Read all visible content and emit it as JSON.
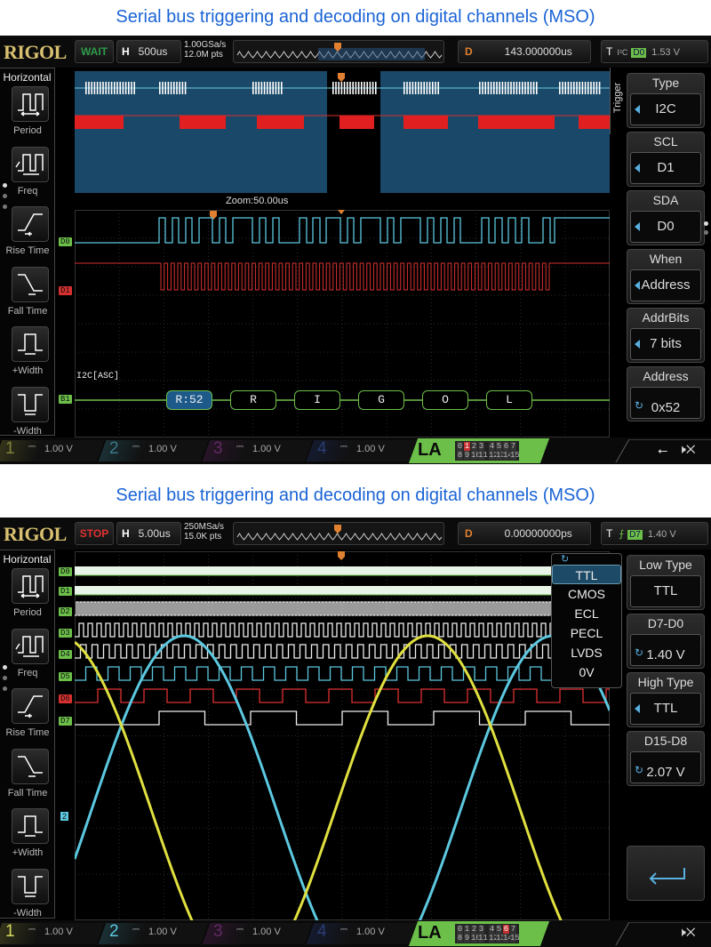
{
  "colors": {
    "d0": "#5cc8e0",
    "d1": "#d83030",
    "bus": "#6cc04a",
    "ch1": "#e0e040",
    "ch2": "#5cc8e0",
    "accent": "#1a64d6"
  },
  "panels": [
    {
      "title": "Serial bus triggering and decoding on digital channels (MSO)",
      "logo": "RIGOL",
      "status": "WAIT",
      "status_color": "#2e9b4a",
      "h_label": "H",
      "h_value": "500us",
      "sample_rate": "1.00GSa/s",
      "mem_depth": "12.0M pts",
      "d_label": "D",
      "d_value": "143.000000us",
      "t_label": "T",
      "t_source_icon": "I²C",
      "t_channel": "D0",
      "t_level": "1.53 V",
      "left_panel": {
        "title": "Horizontal",
        "items": [
          {
            "label": "Period",
            "icon": "period-icon"
          },
          {
            "label": "Freq",
            "icon": "freq-icon"
          },
          {
            "label": "Rise Time",
            "icon": "rise-time-icon"
          },
          {
            "label": "Fall Time",
            "icon": "fall-time-icon"
          },
          {
            "label": "+Width",
            "icon": "positive-width-icon"
          },
          {
            "label": "-Width",
            "icon": "negative-width-icon"
          }
        ]
      },
      "zoom_label": "Zoom:50.00us",
      "channel_tags": [
        "D0",
        "D1",
        "B1"
      ],
      "bus_label": "I2C[ASC]",
      "decode_frames": [
        "R:52",
        "R",
        "I",
        "G",
        "O",
        "L"
      ],
      "menu_title": "Trigger",
      "right_panel": [
        {
          "label": "Type",
          "value": "I2C",
          "control": "arrow"
        },
        {
          "label": "SCL",
          "value": "D1",
          "control": "arrow"
        },
        {
          "label": "SDA",
          "value": "D0",
          "control": "arrow"
        },
        {
          "label": "When",
          "value": "Address",
          "control": "arrow"
        },
        {
          "label": "AddrBits",
          "value": "7 bits",
          "control": "arrow"
        },
        {
          "label": "Address",
          "value": "0x52",
          "control": "knob"
        }
      ],
      "channels": [
        {
          "num": "1",
          "value": "1.00 V"
        },
        {
          "num": "2",
          "value": "1.00 V"
        },
        {
          "num": "3",
          "value": "1.00 V"
        },
        {
          "num": "4",
          "value": "1.00 V"
        }
      ],
      "la": {
        "label": "LA",
        "row1": [
          "0",
          "1",
          "2",
          "3",
          "4",
          "5",
          "6",
          "7"
        ],
        "row2": [
          "8",
          "9",
          "10",
          "11",
          "12",
          "13",
          "14",
          "15"
        ],
        "active": [
          "1"
        ]
      },
      "status_icons": [
        "usb-icon",
        "speaker-mute-icon"
      ]
    },
    {
      "title": "Serial bus triggering and decoding on digital channels (MSO)",
      "logo": "RIGOL",
      "status": "STOP",
      "status_color": "#e03030",
      "h_label": "H",
      "h_value": "5.00us",
      "sample_rate": "250MSa/s",
      "mem_depth": "15.0K pts",
      "d_label": "D",
      "d_value": "0.00000000ps",
      "t_label": "T",
      "t_source_icon": "rising-edge",
      "t_channel": "D7",
      "t_level": "1.40 V",
      "left_panel": {
        "title": "Horizontal",
        "items": [
          {
            "label": "Period",
            "icon": "period-icon"
          },
          {
            "label": "Freq",
            "icon": "freq-icon"
          },
          {
            "label": "Rise Time",
            "icon": "rise-time-icon"
          },
          {
            "label": "Fall Time",
            "icon": "fall-time-icon"
          },
          {
            "label": "+Width",
            "icon": "positive-width-icon"
          },
          {
            "label": "-Width",
            "icon": "negative-width-icon"
          }
        ]
      },
      "channel_tags": [
        "D0",
        "D1",
        "D2",
        "D3",
        "D4",
        "D5",
        "D6",
        "D7"
      ],
      "analog_tag": "2",
      "dropdown": {
        "options": [
          "TTL",
          "CMOS",
          "ECL",
          "PECL",
          "LVDS",
          "0V"
        ],
        "selected": "TTL"
      },
      "right_panel": [
        {
          "label": "Low Type",
          "value": "TTL",
          "control": "none"
        },
        {
          "label": "D7-D0",
          "value": "1.40 V",
          "control": "knob"
        },
        {
          "label": "High Type",
          "value": "TTL",
          "control": "arrow"
        },
        {
          "label": "D15-D8",
          "value": "2.07 V",
          "control": "knob"
        }
      ],
      "return_icon": "return-icon",
      "channels": [
        {
          "num": "1",
          "value": "1.00 V"
        },
        {
          "num": "2",
          "value": "1.00 V"
        },
        {
          "num": "3",
          "value": "1.00 V"
        },
        {
          "num": "4",
          "value": "1.00 V"
        }
      ],
      "la": {
        "label": "LA",
        "row1": [
          "0",
          "1",
          "2",
          "3",
          "4",
          "5",
          "6",
          "7"
        ],
        "row2": [
          "8",
          "9",
          "10",
          "11",
          "12",
          "13",
          "14",
          "15"
        ],
        "active": [
          "6"
        ]
      },
      "status_icons": [
        "speaker-mute-icon"
      ]
    }
  ]
}
